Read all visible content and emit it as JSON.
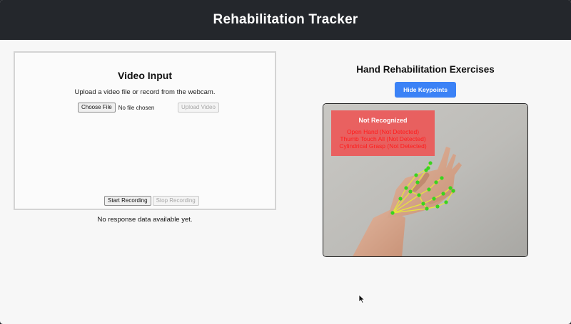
{
  "header": {
    "title": "Rehabilitation Tracker"
  },
  "video_input": {
    "title": "Video Input",
    "description": "Upload a video file or record from the webcam.",
    "choose_file_label": "Choose File",
    "file_status": "No file chosen",
    "upload_label": "Upload Video",
    "start_label": "Start Recording",
    "stop_label": "Stop Recording"
  },
  "response": {
    "text": "No response data available yet."
  },
  "exercises": {
    "title": "Hand Rehabilitation Exercises",
    "toggle_label": "Hide Keypoints",
    "status": "Not Recognized",
    "results": [
      "Open Hand (Not Detected)",
      "Thumb Touch All (Not Detected)",
      "Cylindrical Grasp (Not Detected)"
    ]
  },
  "colors": {
    "header_bg": "#24272c",
    "accent_button": "#3b82f6",
    "overlay_bg": "#f04b4b",
    "overlay_text": "#ff1d1d",
    "keypoint": "#39d41e",
    "skeleton": "#e7e83a"
  },
  "icons": {
    "pointer": "cursor-arrow-icon"
  }
}
